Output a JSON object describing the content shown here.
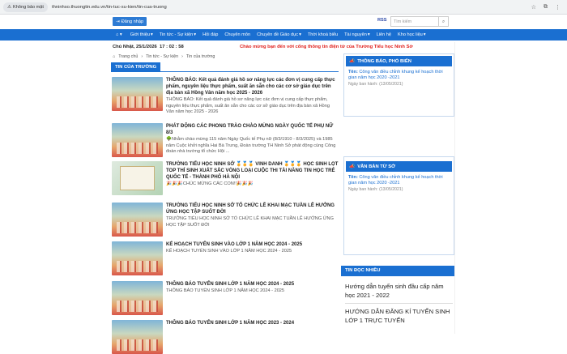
{
  "browser": {
    "security_label": "Không bảo mật",
    "url": "thninhso.thuongtin.edu.vn/tin-tuc-su-kien/tin-cua-truong"
  },
  "topbar": {
    "login_label": "Đăng nhập",
    "rss_label": "RSS",
    "search_placeholder": "Tìm kiếm"
  },
  "nav": {
    "items": [
      {
        "label": "Giới thiệu"
      },
      {
        "label": "Tin tức - Sự kiện"
      },
      {
        "label": "Hỏi đáp"
      },
      {
        "label": "Chuyên môn"
      },
      {
        "label": "Chuyên đề Giáo dục"
      },
      {
        "label": "Thời khoá biểu"
      },
      {
        "label": "Tài nguyên"
      },
      {
        "label": "Liên hệ"
      },
      {
        "label": "Kho học liệu"
      }
    ]
  },
  "datebar": {
    "date": "Chủ Nhật, 25/1/2026",
    "time": "17 : 02 : 58",
    "welcome": "Chào mừng bạn đến với cổng thông tin điện tử  của Trường Tiểu học Ninh Sở"
  },
  "breadcrumb": [
    "Trang chủ",
    "Tin tức - Sự kiện",
    "Tin của trường"
  ],
  "section_title": "TIN CỦA TRƯỜNG",
  "articles": [
    {
      "title": "THÔNG BÁO: Kết quả đánh giá hồ sơ năng lực các đơn vị cung cấp thực phẩm, nguyên liệu thực phẩm, suất ăn sẵn cho các cơ sở giáo dục trên địa bàn xã Hồng Vân năm học 2025 - 2026",
      "summary": "THÔNG BÁO: Kết quả đánh giá hồ sơ năng lực các đơn vị cung cấp thực phẩm, nguyên liệu thực phẩm, suất ăn sẵn cho các cơ sở giáo dục trên địa bàn xã Hồng Vân năm học 2025 - 2026"
    },
    {
      "title": "PHÁT ĐỘNG CÁC PHONG TRÀO CHÀO MỪNG NGÀY QUỐC TẾ PHỤ NỮ 8/3",
      "summary": "🌳Nhằm chào mừng 115 năm Ngày Quốc tế Phụ nữ (8/3/1910 - 8/3/2025) và 1985 năm Cuộc khởi nghĩa Hai Bà Trưng, Đoàn trường TH Ninh Sở phát động cùng Công đoàn nhà trường tổ chức Hội ..."
    },
    {
      "title": "TRƯỜNG TIỂU HỌC NINH SỞ 🏅🏅🏅 VINH DANH 🏅🏅🏅 HỌC SINH LỌT TOP THÍ SINH XUẤT SẮC VÒNG LOẠI CUỘC THI TÀI NĂNG TIN HỌC TRẺ QUỐC TẾ - THÀNH PHỐ HÀ NỘI",
      "summary": "🎉🎉🎉CHÚC MỪNG CÁC CON!!🎉🎉🎉"
    },
    {
      "title": "TRƯỜNG TIỂU HỌC NINH SỞ TỔ CHỨC LỄ KHAI MẠC TUẦN LỄ HƯỞNG ỨNG HỌC TẬP SUỐT ĐỜI",
      "summary": "TRƯỜNG TIỂU HỌC NINH SỞ TỔ CHỨC LỄ KHAI MẠC TUẦN LỄ HƯỞNG ỨNG HỌC TẬP SUỐT ĐỜI"
    },
    {
      "title": "KẾ HOẠCH TUYỂN SINH VÀO LỚP 1 NĂM HỌC 2024 - 2025",
      "summary": "KẾ HOẠCH TUYỂN SINH VÀO LỚP 1 NĂM HỌC 2024 - 2025"
    },
    {
      "title": "THÔNG BÁO TUYỂN SINH LỚP 1 NĂM HỌC 2024 - 2025",
      "summary": "THÔNG BÁO TUYỂN SINH LỚP 1 NĂM HỌC 2024 - 2025"
    },
    {
      "title": "THÔNG BÁO TUYỂN SINH LỚP 1 NĂM HỌC 2023 - 2024",
      "summary": ""
    }
  ],
  "sidebar": {
    "announcements": {
      "title": "THÔNG BÁO, PHỔ BIẾN",
      "item_label": "Tên:",
      "item_title": "Công văn điều chỉnh khung kế hoạch thời gian năm học 2020 -2021",
      "item_date": "Ngày ban hành: (13/05/2021)"
    },
    "documents": {
      "title": "VĂN BẢN TỪ SỞ",
      "item_label": "Tên:",
      "item_title": "Công văn điều chỉnh khung kế hoạch thời gian năm học 2020 -2021",
      "item_date": "Ngày ban hành: (13/05/2021)"
    },
    "most_read": {
      "title": "TIN ĐỌC NHIỀU",
      "items": [
        "Hướng dẫn tuyển sinh đầu cấp năm học 2021 - 2022",
        "HƯỚNG DẪN ĐĂNG KÍ TUYỂN SINH LỚP 1 TRỰC TUYẾN"
      ]
    }
  },
  "colors": {
    "primary": "#1a6fd1",
    "welcome": "#e0201c"
  }
}
